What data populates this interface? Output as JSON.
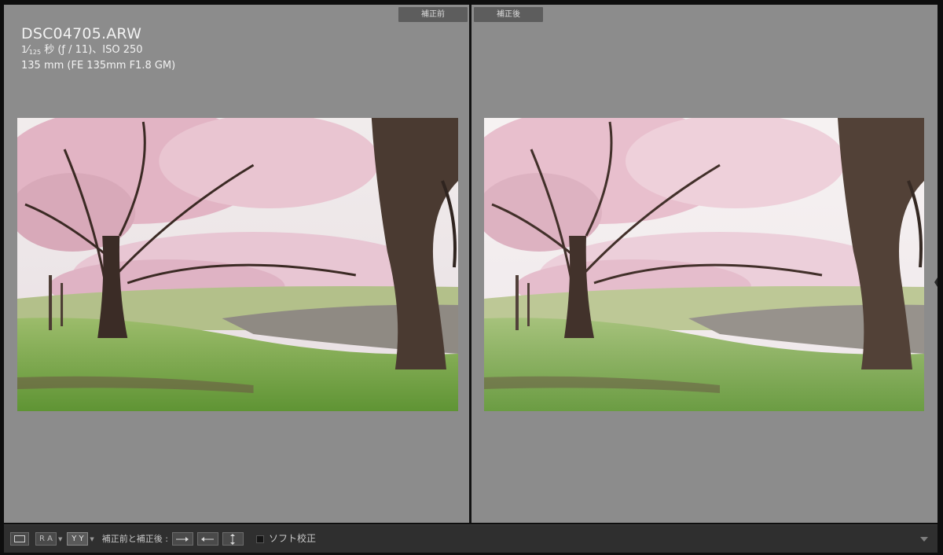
{
  "before_pane": {
    "tag": "補正前",
    "filename": "DSC04705.ARW",
    "shutter_numerator": "1",
    "shutter_denominator": "125",
    "exposure_rest": " 秒 (ƒ / 11)、ISO 250",
    "lens_line": "135 mm (FE 135mm F1.8 GM)"
  },
  "after_pane": {
    "tag": "補正後"
  },
  "toolbar": {
    "view_single_icon": "single-view-icon",
    "ra_label": "R A",
    "yy_label": "Y Y",
    "before_after_label": "補正前と補正後 :",
    "copy_before_to_after_icon": "copy-right-arrow-icon",
    "copy_after_to_before_icon": "copy-left-arrow-icon",
    "swap_icon": "swap-vertical-icon",
    "soft_proof_label": "ソフト校正",
    "soft_proof_checked": false,
    "menu_icon": "triangle-down-icon"
  },
  "colors": {
    "pane_bg": "#8c8c8c",
    "tag_bg": "#5d5d5d",
    "toolbar_bg": "#2f2f2f",
    "grass": "#6fa03f",
    "blossom": "#e5b9c8"
  }
}
